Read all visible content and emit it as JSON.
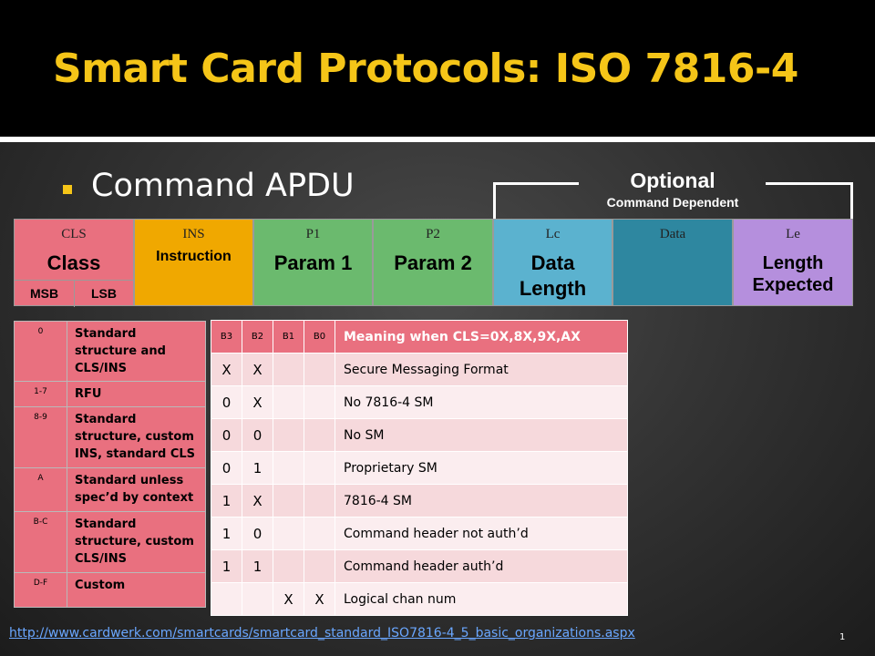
{
  "slide": {
    "title": "Smart Card Protocols: ISO 7816-4",
    "bullet": "Command APDU",
    "optional_label": "Optional",
    "optional_sub": "Command Dependent",
    "page_number": "1"
  },
  "apdu": {
    "cls": {
      "field": "CLS",
      "name": "Class",
      "msb": "MSB",
      "lsb": "LSB",
      "color": "#e9707f"
    },
    "ins": {
      "field": "INS",
      "name": "Instruction",
      "color": "#f0a800"
    },
    "p1": {
      "field": "P1",
      "name": "Param 1",
      "color": "#6bba6e"
    },
    "p2": {
      "field": "P2",
      "name": "Param 2",
      "color": "#6bba6e"
    },
    "lc": {
      "field": "Lc",
      "name_line1": "Data",
      "name_line2": "Length",
      "color": "#5bb2cf"
    },
    "data": {
      "field": "Data",
      "color": "#2e87a0"
    },
    "le": {
      "field": "Le",
      "name_line1": "Length",
      "name_line2": "Expected",
      "color": "#b58fdd"
    }
  },
  "cls_table": [
    {
      "code": "0",
      "desc": "Standard structure and CLS/INS"
    },
    {
      "code": "1-7",
      "desc": "RFU"
    },
    {
      "code": "8-9",
      "desc": "Standard structure, custom INS, standard CLS"
    },
    {
      "code": "A",
      "desc": "Standard unless spec’d by context"
    },
    {
      "code": "B-C",
      "desc": "Standard structure, custom CLS/INS"
    },
    {
      "code": "D-F",
      "desc": "Custom"
    }
  ],
  "b_table": {
    "headers": [
      "B3",
      "B2",
      "B1",
      "B0",
      "Meaning when CLS=0X,8X,9X,AX"
    ],
    "rows": [
      [
        "X",
        "X",
        "",
        "",
        "Secure Messaging Format"
      ],
      [
        "0",
        "X",
        "",
        "",
        "No 7816-4 SM"
      ],
      [
        "0",
        "0",
        "",
        "",
        "No SM"
      ],
      [
        "0",
        "1",
        "",
        "",
        "Proprietary SM"
      ],
      [
        "1",
        "X",
        "",
        "",
        "7816-4 SM"
      ],
      [
        "1",
        "0",
        "",
        "",
        "Command header not auth’d"
      ],
      [
        "1",
        "1",
        "",
        "",
        "Command header auth’d"
      ],
      [
        "",
        "",
        "X",
        "X",
        "Logical chan num"
      ]
    ]
  },
  "link": {
    "text": "http://www.cardwerk.com/smartcards/smartcard_standard_ISO7816-4_5_basic_organizations.aspx"
  },
  "colors": {
    "title": "#f5c518",
    "header_bg": "#000000",
    "table_header": "#e9707f",
    "row_odd": "#f6d9dc",
    "row_even": "#fbedef",
    "link": "#6aa7ff"
  }
}
